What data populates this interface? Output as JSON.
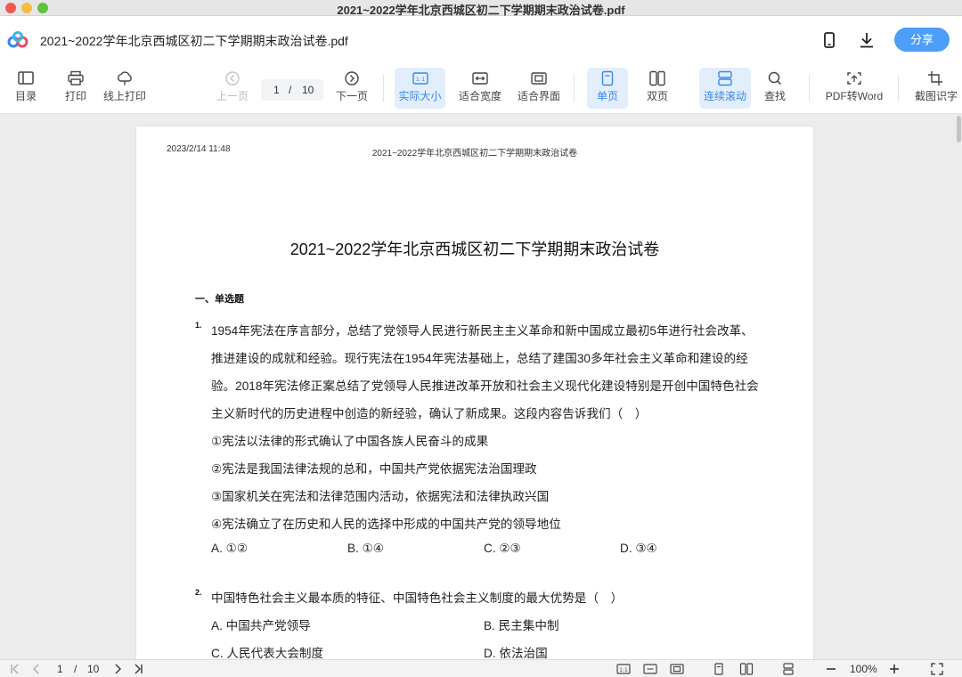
{
  "window": {
    "title": "2021~2022学年北京西城区初二下学期期末政治试卷.pdf"
  },
  "header": {
    "doc_title": "2021~2022学年北京西城区初二下学期期末政治试卷.pdf",
    "share_label": "分享",
    "share_color": "#4c9ef7",
    "icons": [
      "app-logo-icon",
      "mobile-icon",
      "download-icon"
    ]
  },
  "toolbar": {
    "toc_label": "目录",
    "print_label": "打印",
    "online_print_label": "线上打印",
    "prev_label": "上一页",
    "page_current": "1",
    "page_sep": "/",
    "page_total": "10",
    "next_label": "下一页",
    "actual_size_label": "实际大小",
    "fit_width_label": "适合宽度",
    "fit_screen_label": "适合界面",
    "single_page_label": "单页",
    "double_page_label": "双页",
    "continuous_label": "连续滚动",
    "find_label": "查找",
    "pdf_to_word_label": "PDF转Word",
    "screenshot_ocr_label": "截图识字",
    "active_color": "#3a86e8"
  },
  "document": {
    "date": "2023/2/14 11:48",
    "running_header": "2021~2022学年北京西城区初二下学期期末政治试卷",
    "title": "2021~2022学年北京西城区初二下学期期末政治试卷",
    "section": "一、单选题",
    "q1": {
      "num": "1.",
      "lines": [
        "1954年宪法在序言部分，总结了党领导人民进行新民主主义革命和新中国成立最初5年进行社会改革、",
        "推进建设的成就和经验。现行宪法在1954年宪法基础上，总结了建国30多年社会主义革命和建设的经",
        "验。2018年宪法修正案总结了党领导人民推进改革开放和社会主义现代化建设特别是开创中国特色社会",
        "主义新时代的历史进程中创造的新经验，确认了新成果。这段内容告诉我们（　）",
        "①宪法以法律的形式确认了中国各族人民奋斗的成果",
        "②宪法是我国法律法规的总和，中国共产党依据宪法治国理政",
        "③国家机关在宪法和法律范围内活动，依据宪法和法律执政兴国",
        "④宪法确立了在历史和人民的选择中形成的中国共产党的领导地位"
      ],
      "options": [
        "A. ①②",
        "B. ①④",
        "C. ②③",
        "D. ③④"
      ]
    },
    "q2": {
      "num": "2.",
      "stem": "中国特色社会主义最本质的特征、中国特色社会主义制度的最大优势是（　）",
      "options": [
        "A. 中国共产党领导",
        "B. 民主集中制",
        "C. 人民代表大会制度",
        "D. 依法治国"
      ]
    }
  },
  "statusbar": {
    "page_current": "1",
    "page_sep": "/",
    "page_total": "10",
    "zoom": "100%"
  }
}
